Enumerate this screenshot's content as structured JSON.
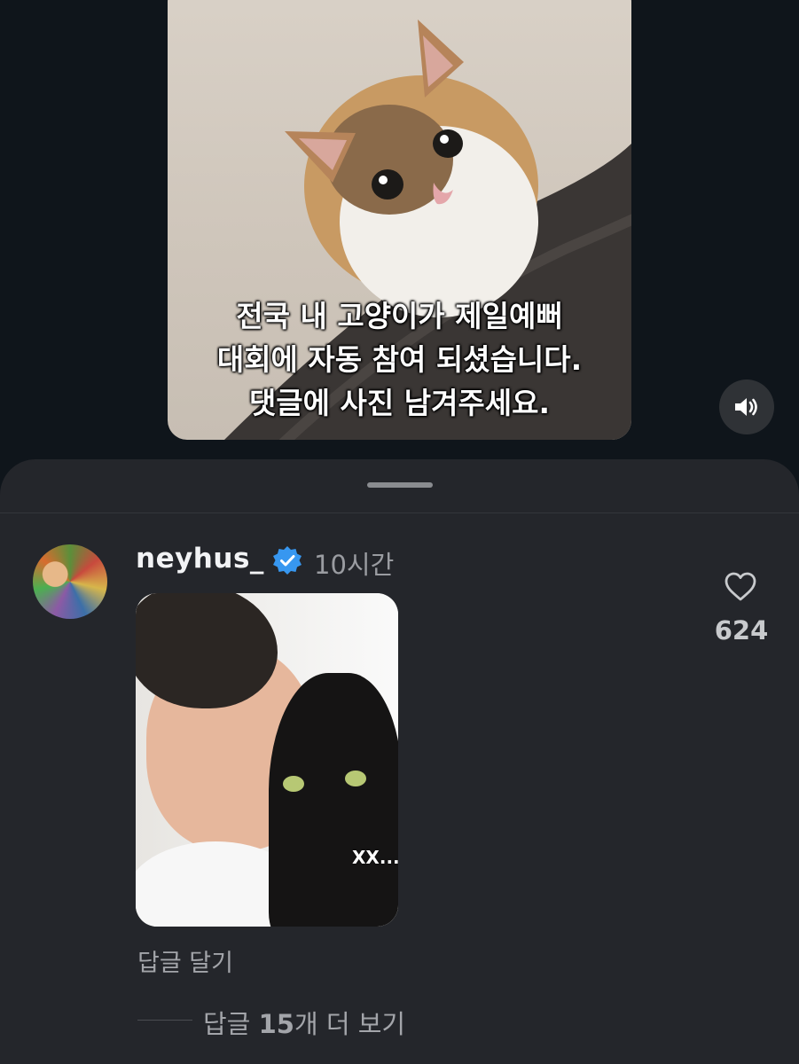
{
  "video": {
    "caption_lines": [
      "전국 내 고양이가 제일예뻐",
      "대회에 자동 참여 되셨습니다.",
      "댓글에 사진 남겨주세요."
    ],
    "sound_icon": "speaker-on-icon"
  },
  "comment": {
    "username": "neyhus_",
    "verified_icon": "verified-badge-icon",
    "time_ago": "10시간",
    "photo_overlay_text": "XX...",
    "reply_label": "답글 달기",
    "more_replies_prefix": "답글 ",
    "more_replies_count": "15",
    "more_replies_suffix": "개 더 보기",
    "like_icon": "heart-outline-icon",
    "like_count": "624"
  }
}
